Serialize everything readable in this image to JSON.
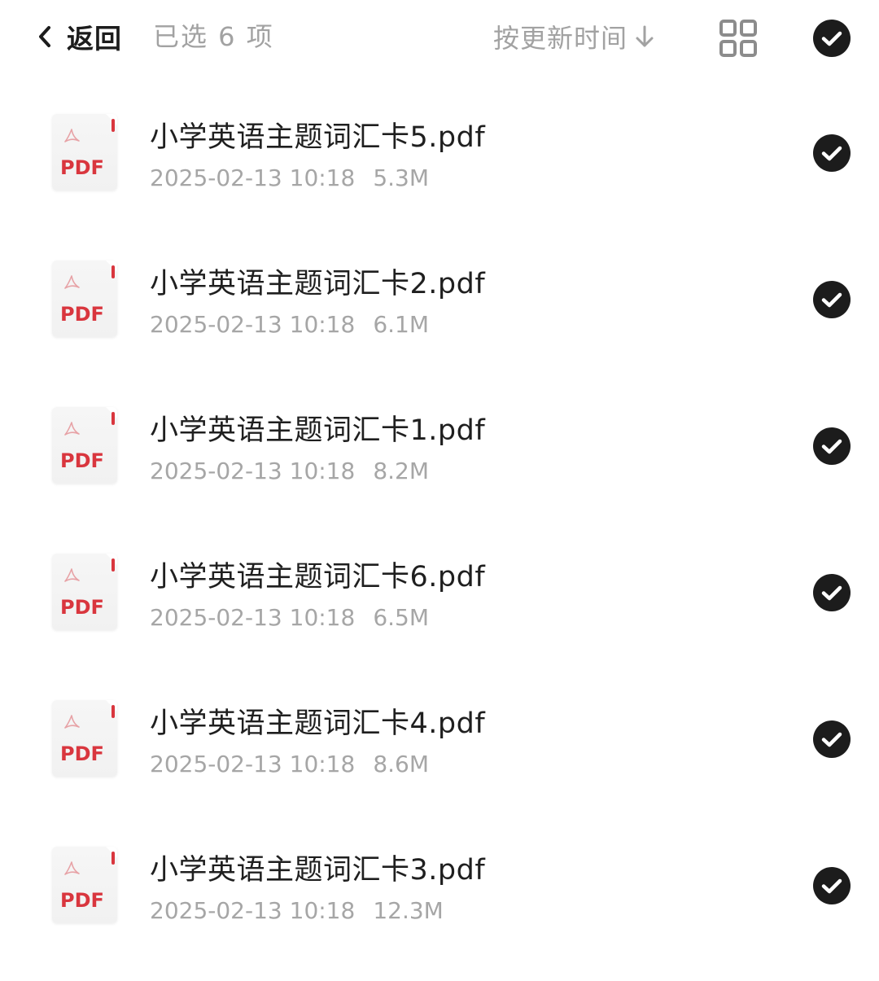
{
  "header": {
    "back_label": "返回",
    "selected_text": "已选 6 项",
    "sort_label": "按更新时间"
  },
  "icons": {
    "back": "chevron-left-icon",
    "sort": "arrow-down-icon",
    "grid": "grid-view-icon",
    "check": "check-circle-icon",
    "file": "pdf-file-icon"
  },
  "colors": {
    "check_fill": "#1c1c1c",
    "pdf_red": "#d9363e",
    "muted_text": "#a6a6a6"
  },
  "files": [
    {
      "name": "小学英语主题词汇卡5.pdf",
      "date": "2025-02-13 10:18",
      "size": "5.3M",
      "badge": "PDF",
      "selected": true
    },
    {
      "name": "小学英语主题词汇卡2.pdf",
      "date": "2025-02-13 10:18",
      "size": "6.1M",
      "badge": "PDF",
      "selected": true
    },
    {
      "name": "小学英语主题词汇卡1.pdf",
      "date": "2025-02-13 10:18",
      "size": "8.2M",
      "badge": "PDF",
      "selected": true
    },
    {
      "name": "小学英语主题词汇卡6.pdf",
      "date": "2025-02-13 10:18",
      "size": "6.5M",
      "badge": "PDF",
      "selected": true
    },
    {
      "name": "小学英语主题词汇卡4.pdf",
      "date": "2025-02-13 10:18",
      "size": "8.6M",
      "badge": "PDF",
      "selected": true
    },
    {
      "name": "小学英语主题词汇卡3.pdf",
      "date": "2025-02-13 10:18",
      "size": "12.3M",
      "badge": "PDF",
      "selected": true
    }
  ]
}
